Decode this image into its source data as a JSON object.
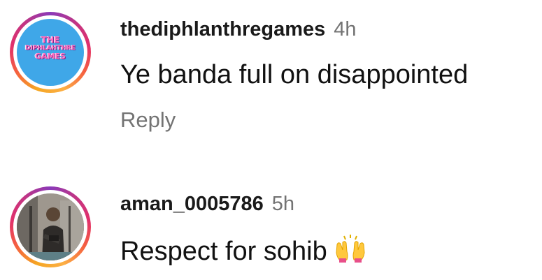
{
  "comments": [
    {
      "avatar_text": [
        "THE",
        "DIPHLAHTHRE",
        "GAMES"
      ],
      "username": "thediphlanthregames",
      "time": "4h",
      "text": "Ye banda full on disappointed",
      "reply_label": "Reply"
    },
    {
      "username": "aman_0005786",
      "time": "5h",
      "text": "Respect for sohib",
      "emoji": "raising-hands-icon"
    }
  ],
  "colors": {
    "username": "#1a1a1a",
    "muted": "#737373",
    "logo_background": "#3fa7e8",
    "logo_text": "#ff6fc1"
  }
}
